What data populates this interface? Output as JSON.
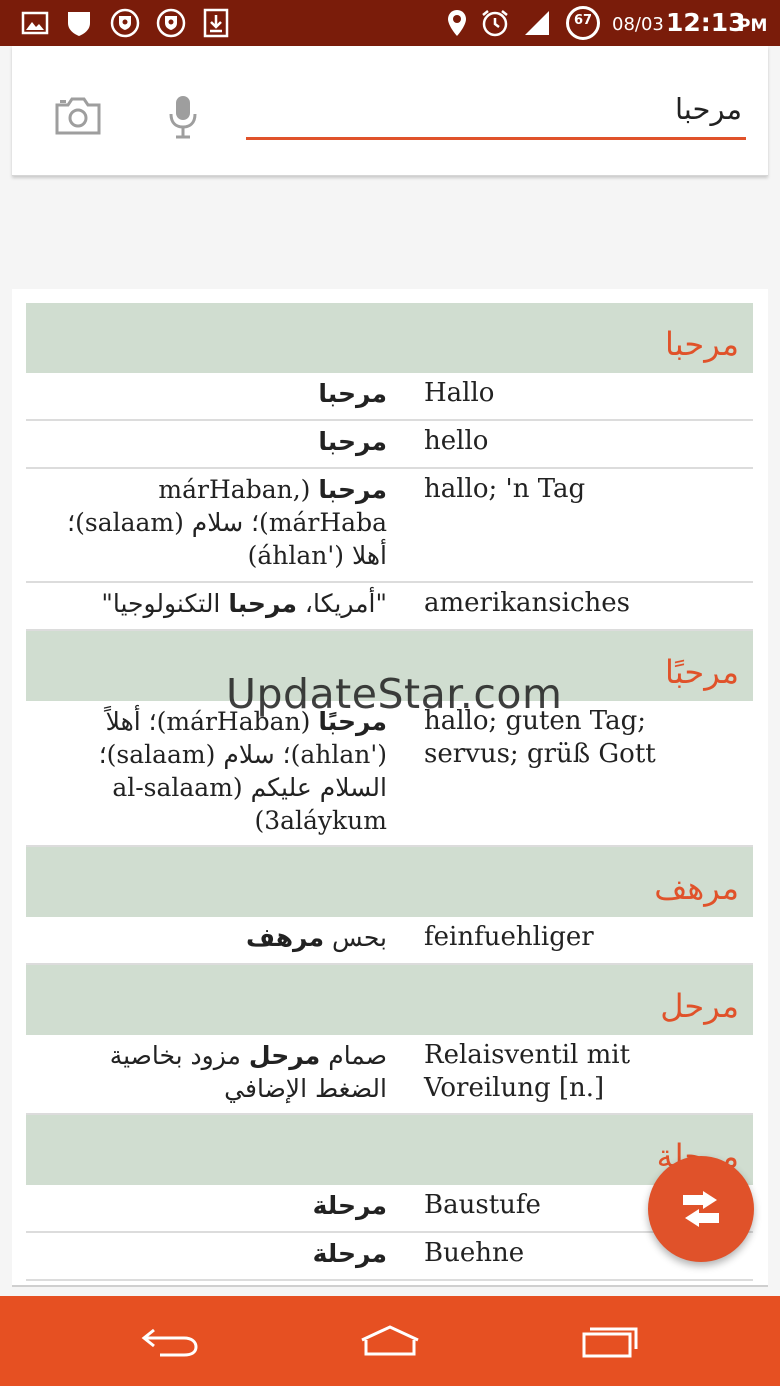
{
  "status_bar": {
    "date": "08/03",
    "time": "12:13",
    "ampm": "PM",
    "battery": "67"
  },
  "search": {
    "query": "مرحبا"
  },
  "watermark": "UpdateStar.com",
  "groups": [
    {
      "title": "مرحبا",
      "rows": [
        {
          "ar_html": "<b>مرحبا</b>",
          "de": "Hallo"
        },
        {
          "ar_html": "<b>مرحبا</b>",
          "de": "hello"
        },
        {
          "ar_html": "<b>مرحبا</b> (márHaban, márHaba)؛ سلام (salaam)؛ أهلا ('áhlan)",
          "de": "hallo; 'n Tag"
        },
        {
          "ar_html": "\"أمريكا، <b>مرحبا</b> التكنولوجيا\"",
          "de": "amerikansiches"
        }
      ]
    },
    {
      "title": "مرحبًا",
      "rows": [
        {
          "ar_html": "<b>مرحبًا</b> (márHaban)؛ أهلاً ('ahlan)؛ سلام (salaam)؛ السلام عليكم (al-salaam 3aláykum)",
          "de": "hallo; guten Tag; servus; grüß Gott"
        }
      ]
    },
    {
      "title": "مرهف",
      "rows": [
        {
          "ar_html": "بحس <b>مرهف</b>",
          "de": "feinfuehliger"
        }
      ]
    },
    {
      "title": "مرحل",
      "rows": [
        {
          "ar_html": "صمام <b>مرحل</b> مزود بخاصية الضغط الإضافي",
          "de": "Relaisventil mit Voreilung [n.]"
        }
      ]
    },
    {
      "title": "مرحلة",
      "rows": [
        {
          "ar_html": "<b>مرحلة</b>",
          "de": "Baustufe"
        },
        {
          "ar_html": "<b>مرحلة</b>",
          "de": "Buehne"
        }
      ]
    }
  ],
  "colors": {
    "status_bar": "#7a1c0a",
    "accent": "#e0522a",
    "nav_bar": "#e65022",
    "group_header": "#d0ddd0"
  },
  "icons": {
    "status": [
      "gallery-icon",
      "shield-icon",
      "vpn-shield-icon",
      "vpn-shield-icon",
      "download-icon",
      "location-icon",
      "alarm-icon",
      "signal-icon"
    ],
    "search": [
      "camera-icon",
      "microphone-icon"
    ],
    "fab": "swap-direction-icon",
    "nav": [
      "back-icon",
      "home-icon",
      "recent-apps-icon"
    ]
  }
}
